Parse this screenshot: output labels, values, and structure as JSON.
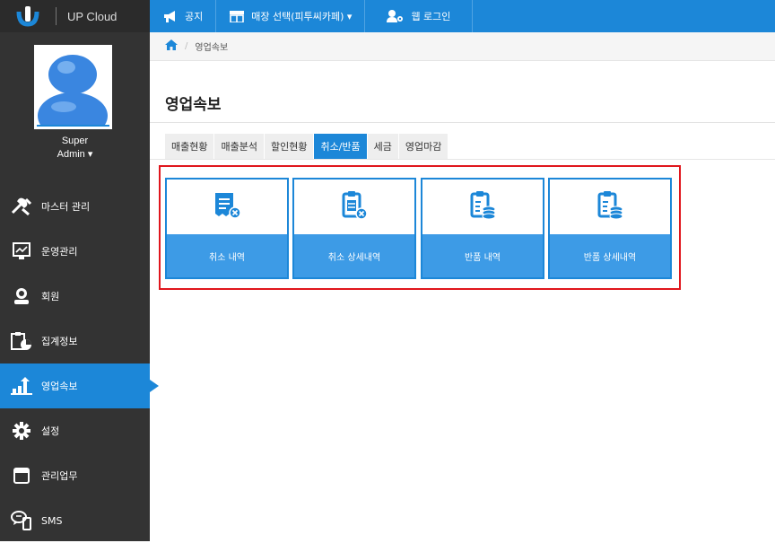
{
  "brand": {
    "name": "UP Cloud"
  },
  "user": {
    "line1": "Super",
    "line2": "Admin ▾"
  },
  "sidebar": {
    "items": [
      {
        "label": "마스터 관리",
        "icon": "tools-icon"
      },
      {
        "label": "운영관리",
        "icon": "monitor-chart-icon"
      },
      {
        "label": "회원",
        "icon": "member-icon"
      },
      {
        "label": "집계정보",
        "icon": "clipboard-chart-icon"
      },
      {
        "label": "영업속보",
        "icon": "bar-chart-arrow-icon",
        "active": true
      },
      {
        "label": "설정",
        "icon": "gear-icon"
      },
      {
        "label": "관리업무",
        "icon": "window-icon"
      },
      {
        "label": "SMS",
        "icon": "sms-icon"
      }
    ]
  },
  "topbar": {
    "notice": "공지",
    "store_select": "매장 선택(피투씨카페) ▾",
    "web_login": "웹 로그인"
  },
  "breadcrumb": {
    "current": "영업속보"
  },
  "page": {
    "title": "영업속보"
  },
  "tabs": [
    {
      "label": "매출현황"
    },
    {
      "label": "매출분석"
    },
    {
      "label": "할인현황"
    },
    {
      "label": "취소/반품",
      "active": true
    },
    {
      "label": "세금"
    },
    {
      "label": "영업마감"
    }
  ],
  "cards": [
    {
      "label": "취소 내역",
      "icon": "receipt-cancel-icon"
    },
    {
      "label": "취소 상세내역",
      "icon": "clipboard-cancel-icon"
    },
    {
      "label": "반품 내역",
      "icon": "clipboard-coins-icon"
    },
    {
      "label": "반품 상세내역",
      "icon": "clipboard-coins-icon"
    }
  ],
  "colors": {
    "accent": "#1c87d8",
    "sidebar": "#333333",
    "highlight": "#e0161d"
  }
}
